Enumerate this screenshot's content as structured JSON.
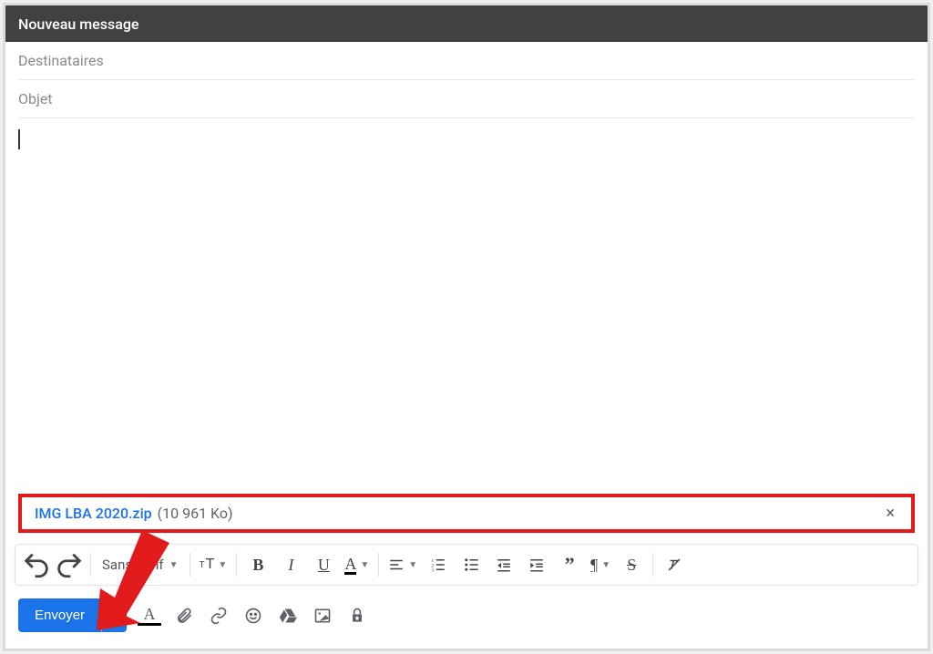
{
  "header": {
    "title": "Nouveau message"
  },
  "fields": {
    "recipients_placeholder": "Destinataires",
    "subject_placeholder": "Objet"
  },
  "attachment": {
    "name": "IMG LBA 2020.zip",
    "size": "(10 961 Ko)"
  },
  "format_toolbar": {
    "font_label": "Sans Serif"
  },
  "bottom": {
    "send_label": "Envoyer"
  },
  "colors": {
    "annotation": "#e11b1b",
    "primary": "#1a73e8"
  }
}
